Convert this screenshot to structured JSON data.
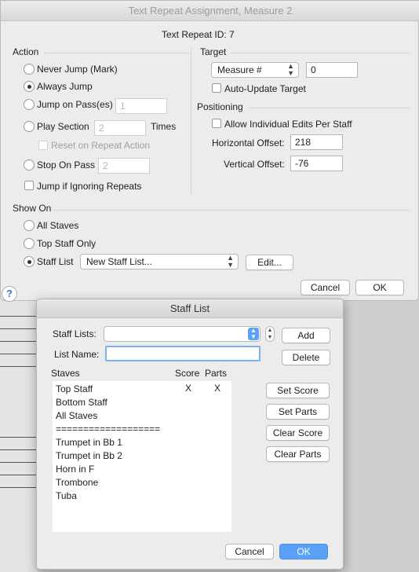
{
  "dialog": {
    "title": "Text Repeat Assignment, Measure 2",
    "repeat_id_text": "Text Repeat ID: 7",
    "action": {
      "header": "Action",
      "never_jump": "Never Jump (Mark)",
      "always_jump": "Always Jump",
      "jump_on_pass": "Jump on Pass(es)",
      "jump_on_pass_value": "1",
      "play_section": "Play Section",
      "play_section_value": "2",
      "times": "Times",
      "reset_on_repeat": "Reset on Repeat Action",
      "stop_on_pass": "Stop On Pass",
      "stop_on_pass_value": "2",
      "jump_if_ignoring": "Jump if Ignoring Repeats",
      "selected": "always_jump"
    },
    "target": {
      "header": "Target",
      "select_value": "Measure #",
      "value": "0",
      "auto_update": "Auto-Update Target"
    },
    "positioning": {
      "header": "Positioning",
      "allow_individual": "Allow Individual Edits Per Staff",
      "h_offset_label": "Horizontal Offset:",
      "h_offset": "218",
      "v_offset_label": "Vertical Offset:",
      "v_offset": "-76"
    },
    "show_on": {
      "header": "Show On",
      "all_staves": "All Staves",
      "top_staff_only": "Top Staff Only",
      "staff_list": "Staff List",
      "staff_list_value": "New Staff List...",
      "edit": "Edit...",
      "selected": "staff_list"
    },
    "cancel": "Cancel",
    "ok": "OK",
    "help": "?"
  },
  "staff_list_dialog": {
    "title": "Staff List",
    "staff_lists_label": "Staff Lists:",
    "staff_lists_value": "",
    "add": "Add",
    "list_name_label": "List Name:",
    "list_name_value": "",
    "delete": "Delete",
    "col_staves": "Staves",
    "col_score": "Score",
    "col_parts": "Parts",
    "rows": [
      {
        "name": "Top Staff",
        "score": "X",
        "parts": "X"
      },
      {
        "name": "Bottom Staff",
        "score": "",
        "parts": ""
      },
      {
        "name": "All Staves",
        "score": "",
        "parts": ""
      },
      {
        "name": "===================",
        "score": "",
        "parts": ""
      },
      {
        "name": "Trumpet in Bb 1",
        "score": "",
        "parts": ""
      },
      {
        "name": "Trumpet in Bb 2",
        "score": "",
        "parts": ""
      },
      {
        "name": "Horn in F",
        "score": "",
        "parts": ""
      },
      {
        "name": "Trombone",
        "score": "",
        "parts": ""
      },
      {
        "name": "Tuba",
        "score": "",
        "parts": ""
      }
    ],
    "set_score": "Set Score",
    "set_parts": "Set Parts",
    "clear_score": "Clear Score",
    "clear_parts": "Clear Parts",
    "cancel": "Cancel",
    "ok": "OK",
    "accent": "#5aa2f7"
  }
}
